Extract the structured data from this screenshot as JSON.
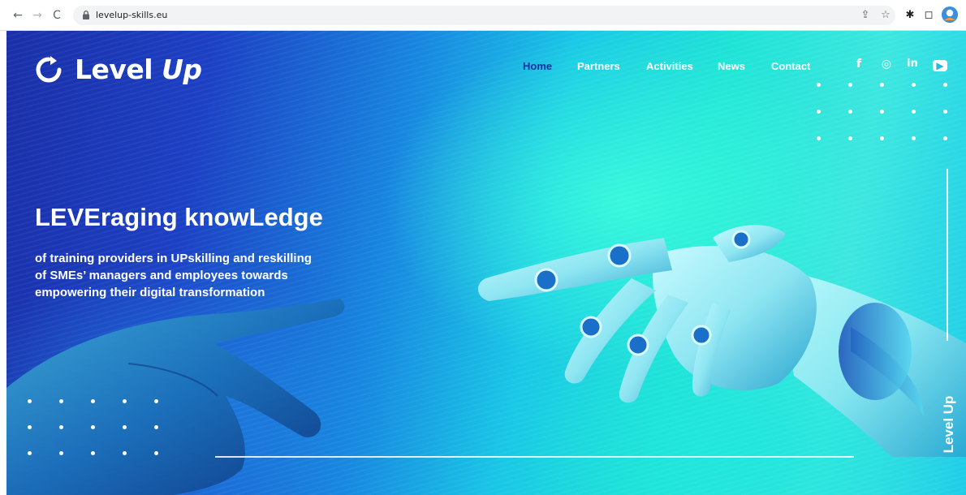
{
  "browser": {
    "url": "levelup-skills.eu",
    "back_icon": "←",
    "forward_icon": "→",
    "reload_icon": "C",
    "share_icon": "⇪",
    "bookmark_icon": "☆",
    "extensions_icon": "✱",
    "sidepanel_icon": "◻"
  },
  "site": {
    "logo_word1": "Level ",
    "logo_word2": "Up",
    "nav": [
      "Home",
      "Partners",
      "Activities",
      "News",
      "Contact"
    ],
    "active_nav": "Home",
    "social": [
      {
        "icon": "facebook-icon",
        "glyph": "f"
      },
      {
        "icon": "instagram-icon",
        "glyph": "◎"
      },
      {
        "icon": "linkedin-icon",
        "glyph": "in"
      },
      {
        "icon": "youtube-icon",
        "glyph": "▶"
      }
    ]
  },
  "hero": {
    "headline": "LEVEraging knowLedge",
    "subtext_line1": "of training providers in UPskilling and reskilling",
    "subtext_line2": "of SMEs’ managers and employees towards",
    "subtext_line3": "empowering their digital transformation",
    "vertical_brand": "Level Up"
  },
  "colors": {
    "accent_dark": "#1a2da0",
    "gradient_left": "#1a2fa8",
    "gradient_right": "#1fe3d6"
  }
}
